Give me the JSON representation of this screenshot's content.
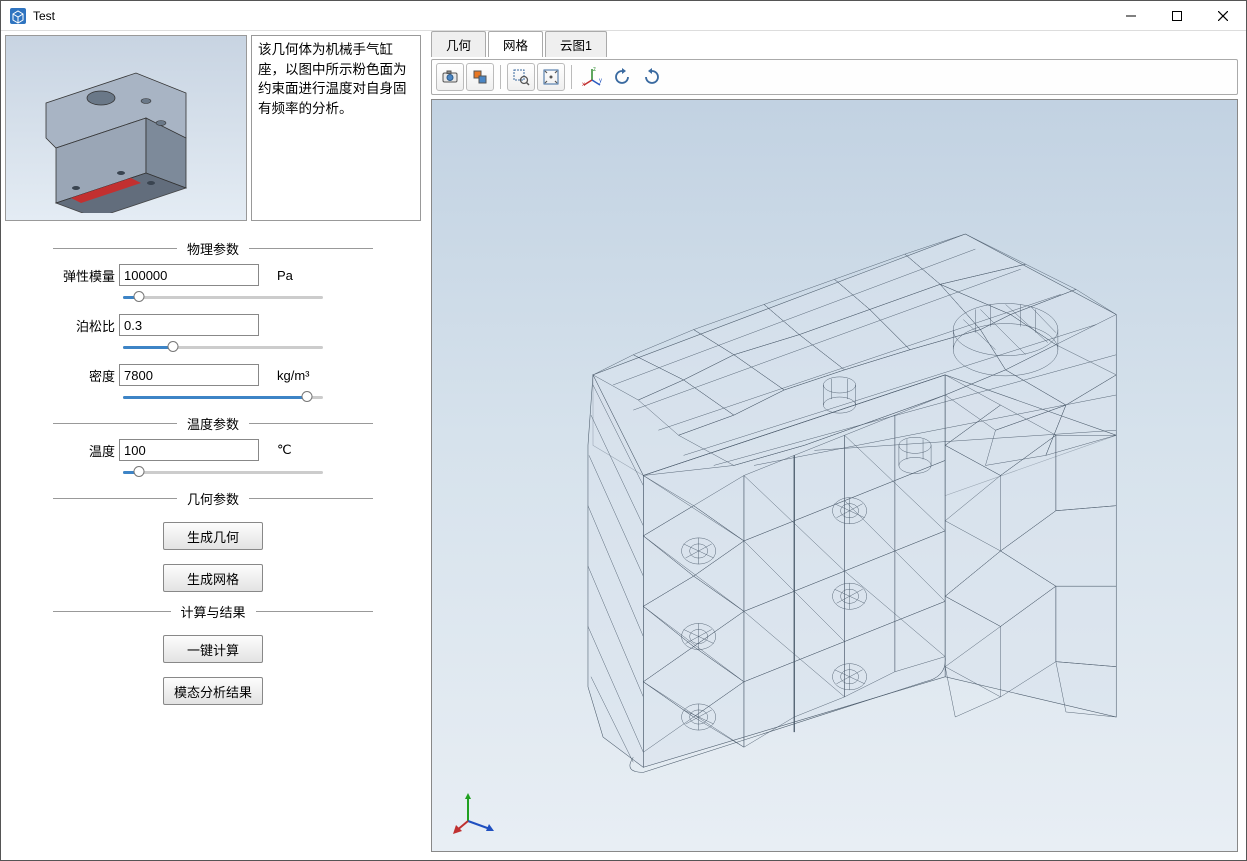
{
  "window": {
    "title": "Test"
  },
  "description": "该几何体为机械手气缸座，以图中所示粉色面为约束面进行温度对自身固有频率的分析。",
  "groups": {
    "physics": "物理参数",
    "temperature": "温度参数",
    "geometry": "几何参数",
    "compute": "计算与结果"
  },
  "params": {
    "elastic": {
      "label": "弹性模量",
      "value": "100000",
      "unit": "Pa",
      "slider_pct": 8
    },
    "poisson": {
      "label": "泊松比",
      "value": "0.3",
      "unit": "",
      "slider_pct": 25
    },
    "density": {
      "label": "密度",
      "value": "7800",
      "unit": "kg/m³",
      "slider_pct": 92
    },
    "temp": {
      "label": "温度",
      "value": "100",
      "unit": "℃",
      "slider_pct": 8
    }
  },
  "buttons": {
    "gen_geom": "生成几何",
    "gen_mesh": "生成网格",
    "compute": "一键计算",
    "modal": "模态分析结果"
  },
  "tabs": [
    {
      "id": "geom",
      "label": "几何",
      "active": false
    },
    {
      "id": "mesh",
      "label": "网格",
      "active": true
    },
    {
      "id": "contour",
      "label": "云图1",
      "active": false
    }
  ],
  "toolbar_icons": {
    "screenshot": "camera-icon",
    "print": "print-layout-icon",
    "zoom_box": "zoom-box-icon",
    "zoom_extents": "zoom-extents-icon",
    "axes": "xyz-axis-icon",
    "rotate_ccw": "rotate-ccw-icon",
    "rotate_cw": "rotate-cw-icon"
  }
}
